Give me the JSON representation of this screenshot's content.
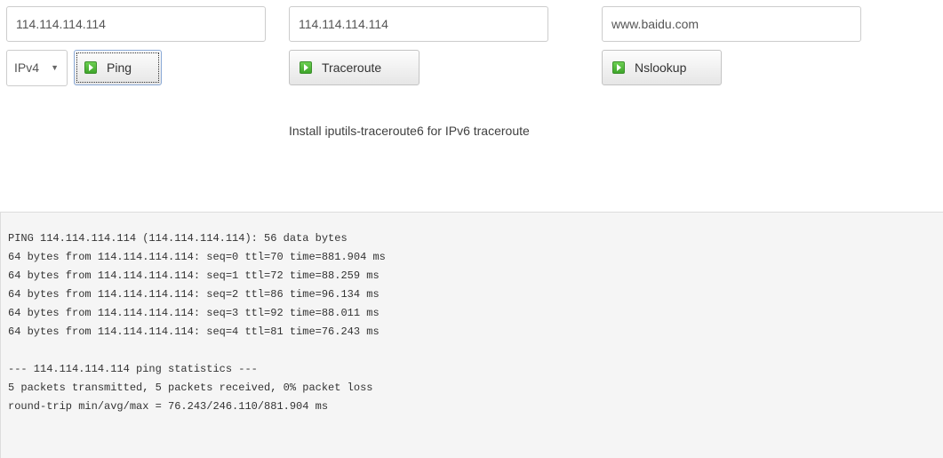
{
  "ping": {
    "host_value": "114.114.114.114",
    "protocol_selected": "IPv4",
    "button_label": "Ping"
  },
  "traceroute": {
    "host_value": "114.114.114.114",
    "button_label": "Traceroute",
    "note": "Install iputils-traceroute6 for IPv6 traceroute"
  },
  "nslookup": {
    "host_value": "www.baidu.com",
    "button_label": "Nslookup"
  },
  "icons": {
    "button_icon": "play-icon",
    "select_caret": "caret-down-icon"
  },
  "colors": {
    "icon_green": "#4caf35",
    "output_background": "#f5f5f5"
  },
  "output": {
    "lines": [
      "PING 114.114.114.114 (114.114.114.114): 56 data bytes",
      "64 bytes from 114.114.114.114: seq=0 ttl=70 time=881.904 ms",
      "64 bytes from 114.114.114.114: seq=1 ttl=72 time=88.259 ms",
      "64 bytes from 114.114.114.114: seq=2 ttl=86 time=96.134 ms",
      "64 bytes from 114.114.114.114: seq=3 ttl=92 time=88.011 ms",
      "64 bytes from 114.114.114.114: seq=4 ttl=81 time=76.243 ms",
      "",
      "--- 114.114.114.114 ping statistics ---",
      "5 packets transmitted, 5 packets received, 0% packet loss",
      "round-trip min/avg/max = 76.243/246.110/881.904 ms"
    ]
  }
}
